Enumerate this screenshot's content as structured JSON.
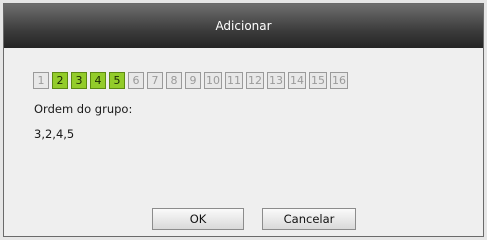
{
  "dialog": {
    "title": "Adicionar",
    "channels": [
      {
        "label": "1",
        "selected": false
      },
      {
        "label": "2",
        "selected": true
      },
      {
        "label": "3",
        "selected": true
      },
      {
        "label": "4",
        "selected": true
      },
      {
        "label": "5",
        "selected": true
      },
      {
        "label": "6",
        "selected": false
      },
      {
        "label": "7",
        "selected": false
      },
      {
        "label": "8",
        "selected": false
      },
      {
        "label": "9",
        "selected": false
      },
      {
        "label": "10",
        "selected": false
      },
      {
        "label": "11",
        "selected": false
      },
      {
        "label": "12",
        "selected": false
      },
      {
        "label": "13",
        "selected": false
      },
      {
        "label": "14",
        "selected": false
      },
      {
        "label": "15",
        "selected": false
      },
      {
        "label": "16",
        "selected": false
      }
    ],
    "group_order_label": "Ordem do grupo:",
    "group_order_value": "3,2,4,5",
    "ok_label": "OK",
    "cancel_label": "Cancelar"
  },
  "colors": {
    "selected_fill": "#93cc2a",
    "titlebar": "#3c3c3c"
  }
}
